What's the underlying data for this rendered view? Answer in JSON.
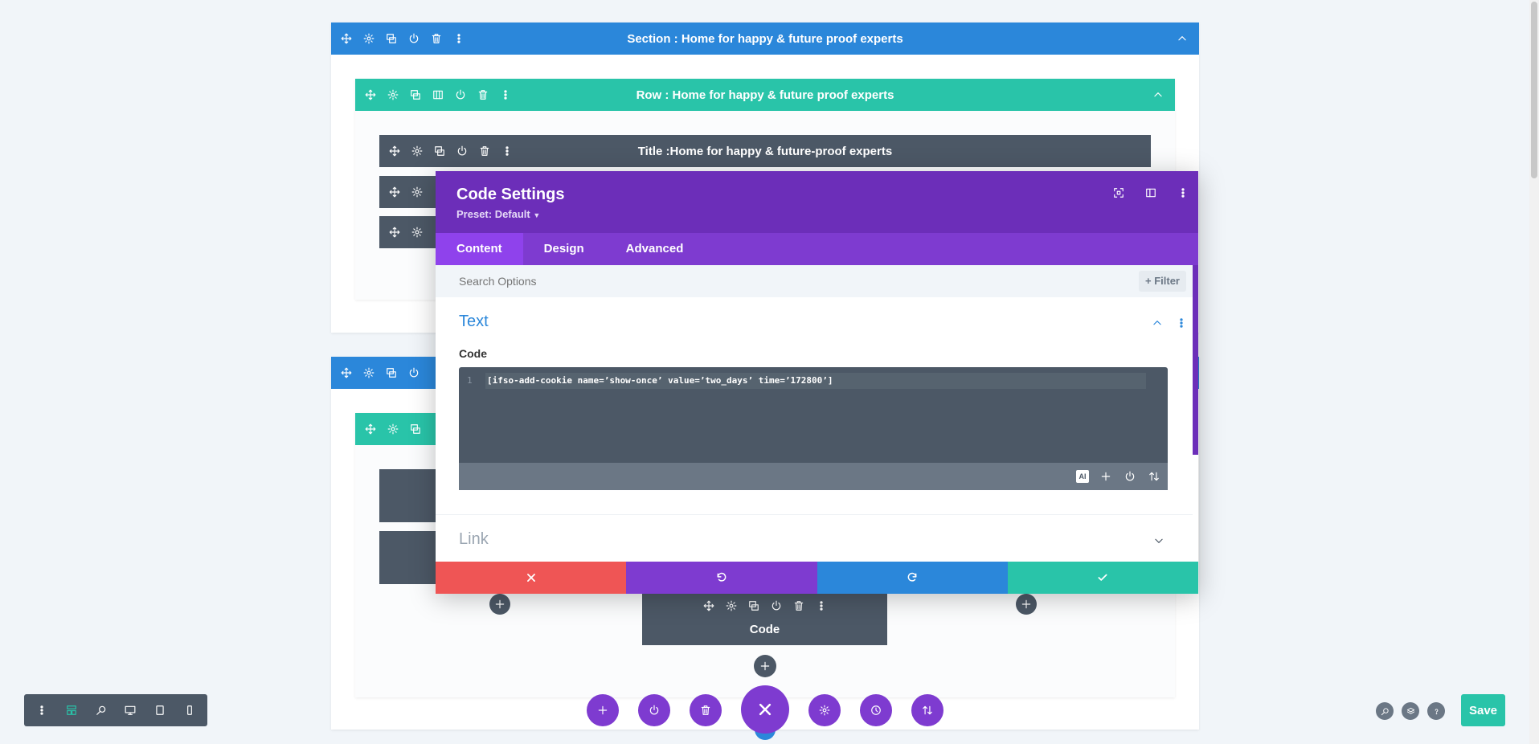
{
  "colors": {
    "section": "#2b87da",
    "row": "#29c4a9",
    "module": "#4c5866",
    "panel_header": "#6c2eb9",
    "tabs": "#7e3bd0",
    "cancel": "#ef5555",
    "undo": "#7e3bd0",
    "redo": "#2b87da",
    "save": "#29c4a9"
  },
  "builder": {
    "section_title": "Section : Home for happy & future proof experts",
    "row_title": "Row : Home for happy & future proof experts",
    "title_module": "Title :Home for happy & future-proof experts",
    "code_module": "Code"
  },
  "panel": {
    "title": "Code Settings",
    "preset": "Preset: Default",
    "tabs": [
      {
        "label": "Content",
        "active": true
      },
      {
        "label": "Design",
        "active": false
      },
      {
        "label": "Advanced",
        "active": false
      }
    ],
    "search_placeholder": "Search Options",
    "filter_label": "Filter",
    "group_text": "Text",
    "field_code_label": "Code",
    "line_number": "1",
    "code_value": "[ifso-add-cookie name=’show-once’ value=’two_days’ time=’172800’]",
    "ai_badge": "AI",
    "group_link": "Link"
  },
  "footer": {
    "save_label": "Save"
  },
  "icons": {
    "move": "move-icon",
    "settings": "gear-icon",
    "duplicate": "duplicate-icon",
    "toggle": "power-icon",
    "delete": "trash-icon",
    "more": "dots-vertical-icon",
    "columns": "columns-icon",
    "collapse": "chevron-up-icon"
  }
}
